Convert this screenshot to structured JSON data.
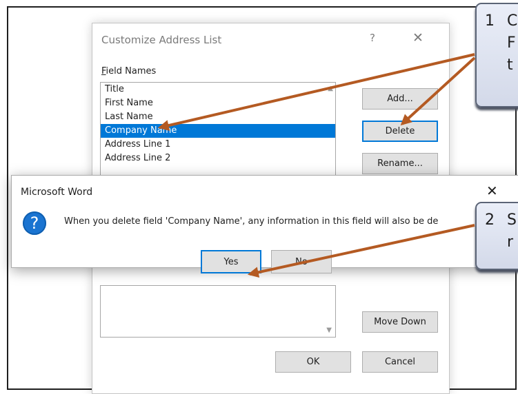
{
  "customize_dialog": {
    "title": "Customize Address List",
    "help": "?",
    "close": "✕",
    "field_names_label": "Field Names",
    "field_names_mnemonic": "F",
    "field_names_rest": "ield Names",
    "fields": [
      "Title",
      "First Name",
      "Last Name",
      "Company Name",
      "Address Line 1",
      "Address Line 2"
    ],
    "selected_field": "Company Name",
    "buttons": {
      "add": "Add...",
      "delete": "Delete",
      "rename": "Rename...",
      "move_down": "Move Down",
      "ok": "OK",
      "cancel": "Cancel"
    }
  },
  "message_box": {
    "title": "Microsoft Word",
    "close": "✕",
    "icon": "question-icon",
    "icon_glyph": "?",
    "message": "When you delete field 'Company Name', any information in this field will also be de",
    "yes": "Yes",
    "no": "No"
  },
  "callouts": [
    {
      "number": "1",
      "lines": [
        "C",
        "F",
        "t"
      ]
    },
    {
      "number": "2",
      "lines": [
        "S",
        "r"
      ]
    }
  ],
  "colors": {
    "selection": "#0078d7",
    "arrow": "#b45a22",
    "question_icon": "#1a74d1",
    "callout_border": "#5b6476"
  }
}
